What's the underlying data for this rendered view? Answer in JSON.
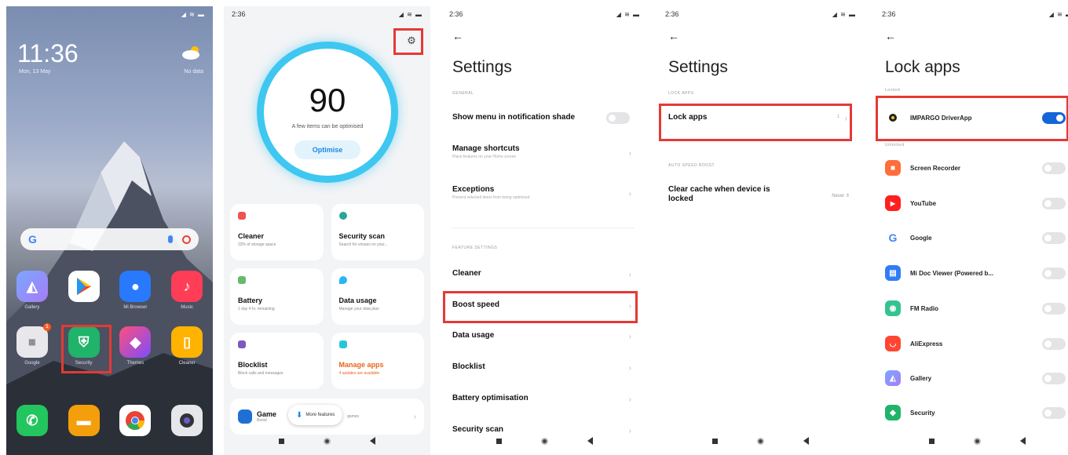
{
  "panel1": {
    "time": "11:36",
    "date": "Mon, 13 May",
    "weather": "No data",
    "apps_row1": [
      {
        "label": "Gallery",
        "icon": "gallery-icon",
        "color": "#6a7ff0"
      },
      {
        "label": "",
        "icon": "play-store-icon",
        "color": "#ffffff"
      },
      {
        "label": "Mi Browser",
        "icon": "browser-icon",
        "color": "#2979ff"
      },
      {
        "label": "Music",
        "icon": "music-icon",
        "color": "#ff3d57"
      }
    ],
    "apps_row2": [
      {
        "label": "Google",
        "icon": "google-folder-icon",
        "color": "#e8e8ec",
        "badge": "1"
      },
      {
        "label": "Security",
        "icon": "security-icon",
        "color": "#20b36a"
      },
      {
        "label": "Themes",
        "icon": "themes-icon",
        "color": "#ff4f7a"
      },
      {
        "label": "Cleaner",
        "icon": "cleaner-icon",
        "color": "#ffb300"
      }
    ],
    "dock": [
      {
        "icon": "phone-icon",
        "color": "#22c55e"
      },
      {
        "icon": "messages-icon",
        "color": "#f59e0b"
      },
      {
        "icon": "chrome-icon",
        "color": "#ffffff"
      },
      {
        "icon": "camera-icon",
        "color": "#e5e7eb"
      }
    ]
  },
  "panel2": {
    "time": "2:36",
    "score": "90",
    "score_sub": "A few items can be optimised",
    "optimise": "Optimise",
    "tiles": [
      {
        "title": "Cleaner",
        "sub": "33% of storage space",
        "color": "#ef5350"
      },
      {
        "title": "Security scan",
        "sub": "Search for viruses on your...",
        "color": "#26a69a"
      },
      {
        "title": "Battery",
        "sub": "1 day 4 hr. remaining",
        "color": "#66bb6a"
      },
      {
        "title": "Data usage",
        "sub": "Manage your data plan",
        "color": "#29b6f6"
      },
      {
        "title": "Blocklist",
        "sub": "Block calls and messages",
        "color": "#7e57c2"
      },
      {
        "title": "Manage apps",
        "sub": "4 updates are available",
        "color": "#26c6da",
        "accent": true
      }
    ],
    "game_title": "Game",
    "game_sub": "Boost",
    "game_tail": "games",
    "more_features": "More features"
  },
  "panel3": {
    "time": "2:36",
    "title": "Settings",
    "section_general": "GENERAL",
    "row_notif": "Show menu in notification shade",
    "row_shortcuts": "Manage shortcuts",
    "row_shortcuts_sub": "Place features on your Home screen",
    "row_exceptions": "Exceptions",
    "row_exceptions_sub": "Prevent selected items from being optimised",
    "section_feature": "FEATURE SETTINGS",
    "rows": [
      "Cleaner",
      "Boost speed",
      "Data usage",
      "Blocklist",
      "Battery optimisation",
      "Security scan"
    ]
  },
  "panel4": {
    "time": "2:36",
    "title": "Settings",
    "section_lock": "LOCK APPS",
    "row_lock": "Lock apps",
    "row_lock_value": "1",
    "section_boost": "AUTO SPEED BOOST",
    "row_cache": "Clear cache when device is locked",
    "row_cache_value": "Never"
  },
  "panel5": {
    "time": "2:36",
    "title": "Lock apps",
    "section_locked": "Locked",
    "locked_app": {
      "name": "IMPARGO DriverApp",
      "color": "#222222"
    },
    "section_unlocked": "Unlocked",
    "apps": [
      {
        "name": "Screen Recorder",
        "color": "#ff6d3a",
        "glyph": "■"
      },
      {
        "name": "YouTube",
        "color": "#ff1f1f",
        "glyph": "▶"
      },
      {
        "name": "Google",
        "color": "#ffffff",
        "glyph": "G"
      },
      {
        "name": "Mi Doc Viewer (Powered b...",
        "color": "#2f7df6",
        "glyph": "▤"
      },
      {
        "name": "FM Radio",
        "color": "#34c38f",
        "glyph": "◉"
      },
      {
        "name": "AliExpress",
        "color": "#ff4632",
        "glyph": "◡"
      },
      {
        "name": "Gallery",
        "color": "#8e9bf5",
        "glyph": "◭"
      },
      {
        "name": "Security",
        "color": "#20b36a",
        "glyph": "◆"
      }
    ]
  }
}
